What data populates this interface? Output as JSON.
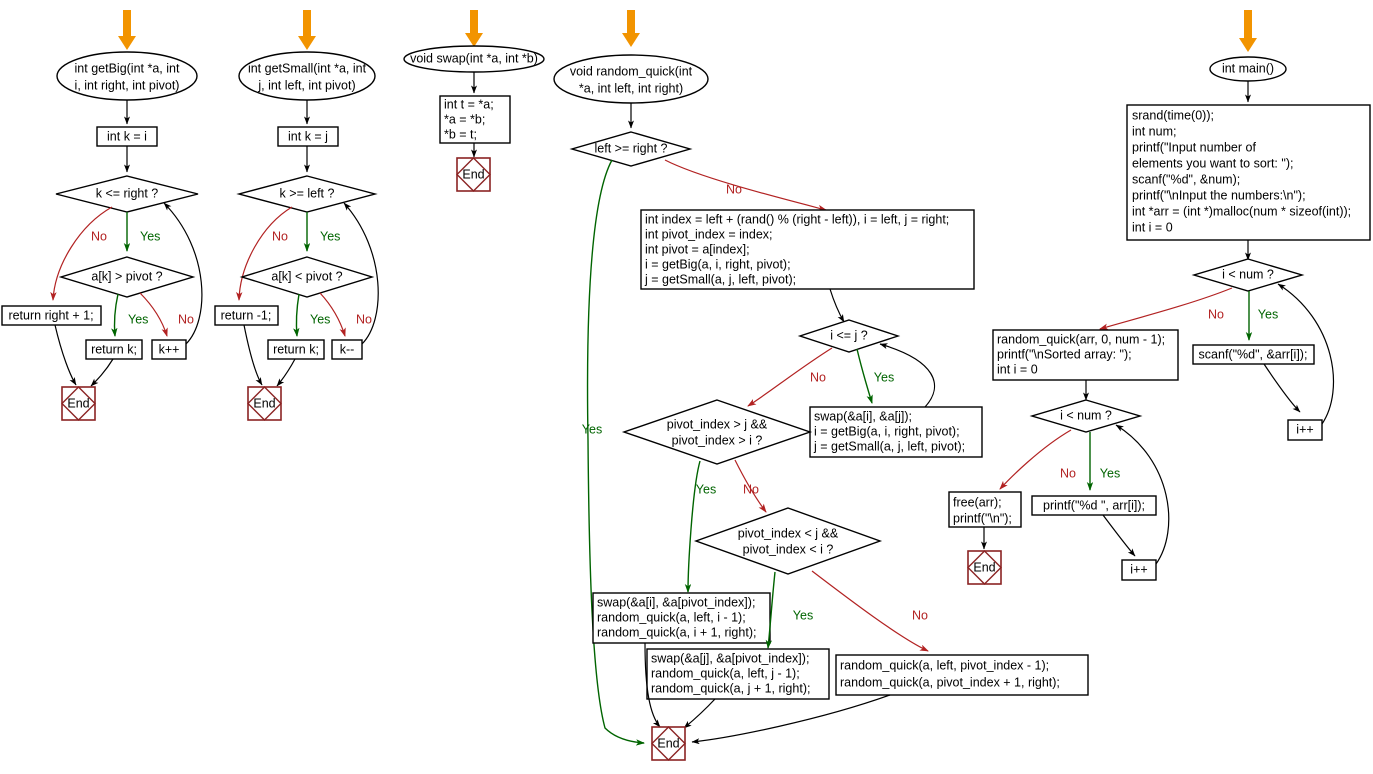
{
  "diagram": {
    "title": "Random Quick Sort flowchart",
    "colors": {
      "yes": "#006400",
      "no": "#B22222",
      "start_arrow": "#F29400",
      "end_node": "#8B2323",
      "node_stroke": "#000000",
      "background": "#FFFFFF"
    },
    "edge_labels": {
      "yes": "Yes",
      "no": "No"
    },
    "end_label": "End"
  },
  "charts": {
    "getBig": {
      "start": {
        "line1": "int getBig(int *a, int",
        "line2": "i, int right, int pivot)"
      },
      "init": "int k = i",
      "cond1": "k <= right ?",
      "cond2": "a[k] > pivot ?",
      "ret_no": "return right + 1;",
      "ret_yes": "return k;",
      "incr": "k++",
      "end": "End",
      "labels": {
        "no1": "No",
        "yes1": "Yes",
        "yes2": "Yes",
        "no2": "No"
      }
    },
    "getSmall": {
      "start": {
        "line1": "int getSmall(int *a, int",
        "line2": "j, int left, int pivot)"
      },
      "init": "int k = j",
      "cond1": "k >= left ?",
      "cond2": "a[k] < pivot ?",
      "ret_no": "return -1;",
      "ret_yes": "return k;",
      "decr": "k--",
      "end": "End",
      "labels": {
        "no1": "No",
        "yes1": "Yes",
        "yes2": "Yes",
        "no2": "No"
      }
    },
    "swap": {
      "start": "void swap(int *a, int *b)",
      "body": [
        "int t = *a;",
        "*a = *b;",
        "*b = t;"
      ],
      "end": "End"
    },
    "random_quick": {
      "start": {
        "line1": "void random_quick(int",
        "line2": "*a, int left, int right)"
      },
      "cond_left_right": "left >= right ?",
      "label_yes_left_right": "Yes",
      "label_no_left_right": "No",
      "setup": [
        "int index = left + (rand() % (right - left)), i = left, j = right;",
        "int pivot_index = index;",
        "int pivot = a[index];",
        "i = getBig(a, i, right, pivot);",
        "j = getSmall(a, j, left, pivot);"
      ],
      "cond_i_le_j": "i <= j ?",
      "label_no_i_le_j": "No",
      "label_yes_i_le_j": "Yes",
      "swap_block": [
        "swap(&a[i], &a[j]);",
        "i = getBig(a, i, right, pivot);",
        "j = getSmall(a, j, left, pivot);"
      ],
      "cond_pivot_gt": {
        "line1": "pivot_index > j &&",
        "line2": "pivot_index > i ?"
      },
      "label_yes_pivot_gt": "Yes",
      "label_no_pivot_gt": "No",
      "cond_pivot_lt": {
        "line1": "pivot_index < j &&",
        "line2": "pivot_index < i ?"
      },
      "label_yes_pivot_lt": "Yes",
      "label_no_pivot_lt": "No",
      "block_i": [
        "swap(&a[i], &a[pivot_index]);",
        "random_quick(a, left, i - 1);",
        "random_quick(a, i + 1, right);"
      ],
      "block_j": [
        "swap(&a[j], &a[pivot_index]);",
        "random_quick(a, left, j - 1);",
        "random_quick(a, j + 1, right);"
      ],
      "block_pivot": [
        "random_quick(a, left, pivot_index - 1);",
        "random_quick(a, pivot_index + 1, right);"
      ],
      "end": "End"
    },
    "main": {
      "start": "int main()",
      "init_block": [
        "srand(time(0));",
        "int num;",
        "printf(\"Input number of",
        "elements you want to sort: \");",
        "scanf(\"%d\", &num);",
        "printf(\"\\nInput the numbers:\\n\");",
        "int *arr = (int *)malloc(num * sizeof(int));",
        "int i = 0"
      ],
      "cond_read": "i < num ?",
      "label_no_read": "No",
      "label_yes_read": "Yes",
      "read_stmt": "scanf(\"%d\", &arr[i]);",
      "incr_read": "i++",
      "sort_block": [
        "random_quick(arr, 0, num - 1);",
        "printf(\"\\nSorted array: \");",
        "int i = 0"
      ],
      "cond_print": "i < num ?",
      "label_no_print": "No",
      "label_yes_print": "Yes",
      "free_block": [
        "free(arr);",
        "printf(\"\\n\");"
      ],
      "print_stmt": "printf(\"%d \", arr[i]);",
      "incr_print": "i++",
      "end": "End"
    }
  }
}
